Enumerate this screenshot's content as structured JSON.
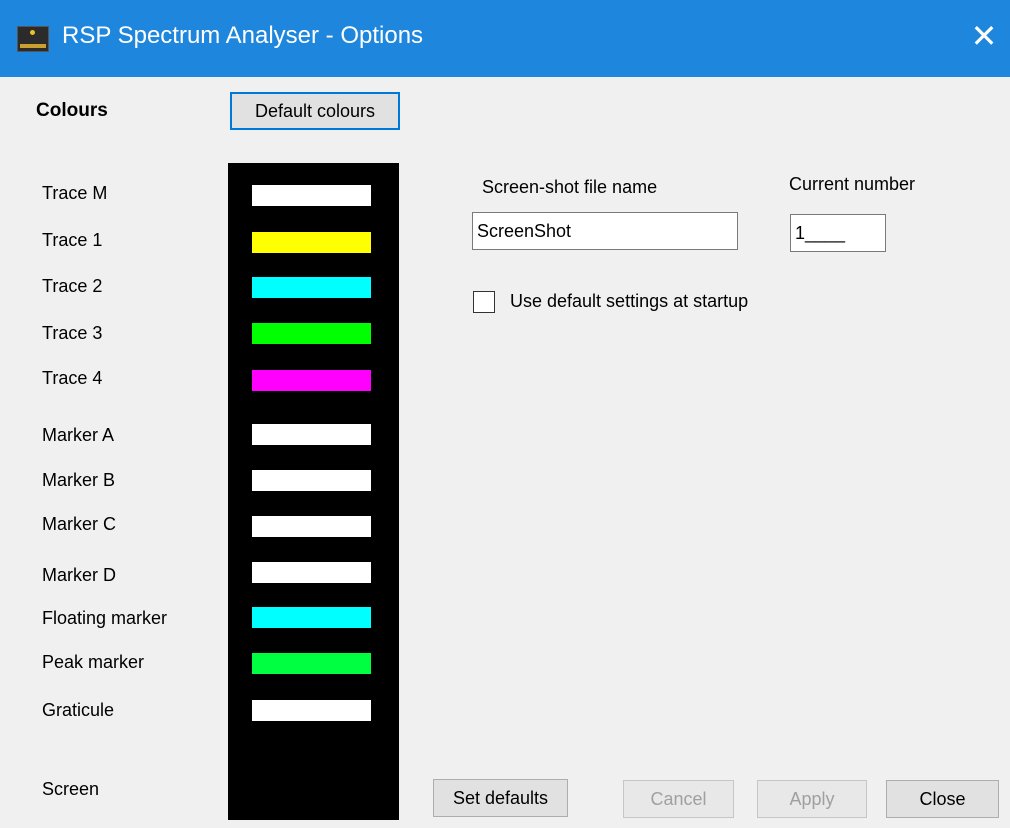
{
  "window": {
    "title": "RSP Spectrum Analyser - Options",
    "close_glyph": "✕",
    "titlebar_color": "#1e86dc"
  },
  "colours": {
    "heading": "Colours",
    "default_button": "Default colours",
    "items": [
      {
        "label": "Trace M",
        "color": "#ffffff"
      },
      {
        "label": "Trace 1",
        "color": "#ffff00"
      },
      {
        "label": "Trace 2",
        "color": "#00ffff"
      },
      {
        "label": "Trace 3",
        "color": "#00ff00"
      },
      {
        "label": "Trace 4",
        "color": "#ff00ff"
      },
      {
        "label": "Marker A",
        "color": "#ffffff"
      },
      {
        "label": "Marker B",
        "color": "#ffffff"
      },
      {
        "label": "Marker C",
        "color": "#ffffff"
      },
      {
        "label": "Marker D",
        "color": "#ffffff"
      },
      {
        "label": "Floating marker",
        "color": "#00ffff"
      },
      {
        "label": "Peak marker",
        "color": "#00ff40"
      },
      {
        "label": "Graticule",
        "color": "#ffffff"
      },
      {
        "label": "Screen",
        "color": "#000000"
      }
    ]
  },
  "screenshot": {
    "file_name_label": "Screen-shot file name",
    "file_name_value": "ScreenShot",
    "current_number_label": "Current number",
    "current_number_value": "1____"
  },
  "startup": {
    "checkbox_label": "Use default settings at startup",
    "checked": false
  },
  "buttons": {
    "set_defaults": "Set defaults",
    "cancel": "Cancel",
    "apply": "Apply",
    "close": "Close"
  }
}
